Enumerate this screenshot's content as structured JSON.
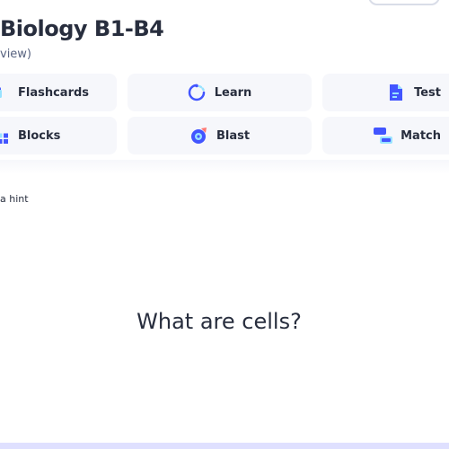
{
  "set": {
    "title": "Biology B1-B4",
    "subtitle": "view)"
  },
  "modes": {
    "flashcards": {
      "label": "Flashcards",
      "icon": "flashcards-icon"
    },
    "learn": {
      "label": "Learn",
      "icon": "learn-icon"
    },
    "test": {
      "label": "Test",
      "icon": "test-icon"
    },
    "blocks": {
      "label": "Blocks",
      "icon": "blocks-icon"
    },
    "blast": {
      "label": "Blast",
      "icon": "blast-icon"
    },
    "match": {
      "label": "Match",
      "icon": "match-icon"
    }
  },
  "card": {
    "hint_label": "a hint",
    "term": "What are cells?"
  },
  "colors": {
    "accent_blue": "#4255ff",
    "accent_cyan": "#98e3ff",
    "accent_pink": "#ff7873",
    "card_background": "#f6f7fb",
    "text": "#282e3e",
    "bottom_bar": "#dfe0ff"
  }
}
